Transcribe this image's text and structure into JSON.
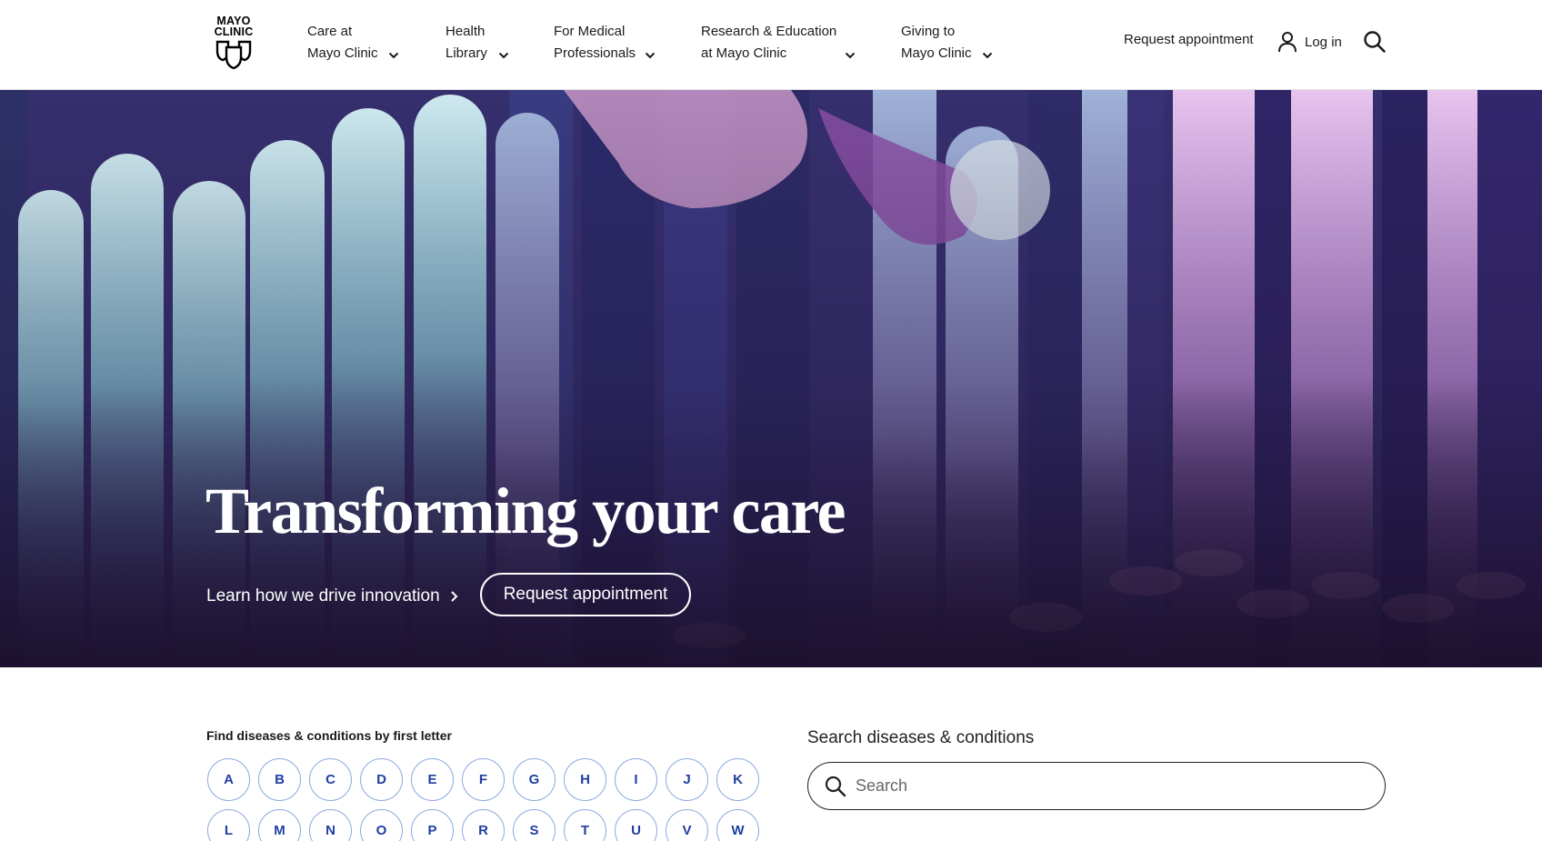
{
  "logo": {
    "line1": "MAYO",
    "line2": "CLINIC",
    "icon": "three-shields-logo"
  },
  "nav": {
    "items": [
      {
        "line1": "Care at",
        "line2": "Mayo Clinic"
      },
      {
        "line1": "Health",
        "line2": "Library"
      },
      {
        "line1": "For Medical",
        "line2": "Professionals"
      },
      {
        "line1": "Research & Education",
        "line2": "at Mayo Clinic"
      },
      {
        "line1": "Giving to",
        "line2": "Mayo Clinic"
      }
    ],
    "request_appointment": "Request appointment",
    "login": "Log in"
  },
  "hero": {
    "title": "Transforming your care",
    "link": "Learn how we drive innovation",
    "button": "Request appointment"
  },
  "conditions": {
    "alpha_title": "Find diseases & conditions by first letter",
    "letters_row1": [
      "A",
      "B",
      "C",
      "D",
      "E",
      "F",
      "G",
      "H",
      "I",
      "J",
      "K"
    ],
    "letters_row2": [
      "L",
      "M",
      "N",
      "O",
      "P",
      "R",
      "S",
      "T",
      "U",
      "V",
      "W"
    ],
    "search_title": "Search diseases & conditions",
    "search_placeholder": "Search"
  },
  "colors": {
    "letter_text": "#1f3fa3",
    "letter_border": "#8aa9de",
    "hero_dark": "#241640"
  }
}
